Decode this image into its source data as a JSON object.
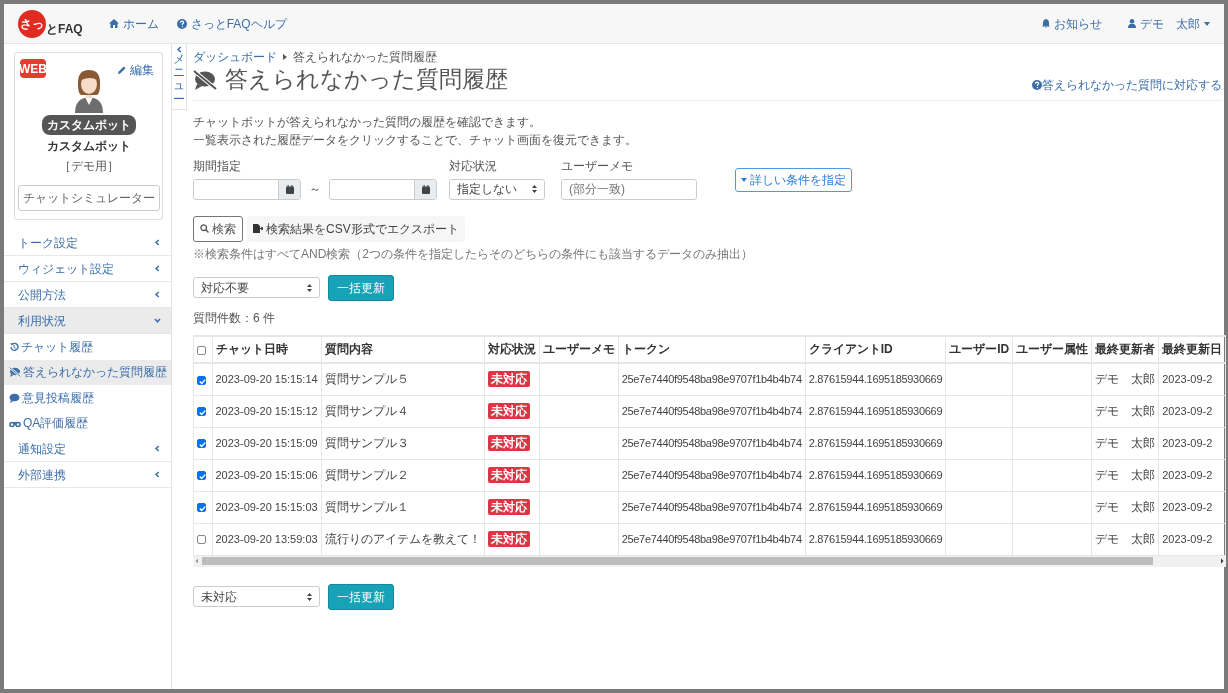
{
  "navbar": {
    "logo": {
      "mark": "さっ",
      "text": "とFAQ"
    },
    "links": [
      {
        "label": "ホーム"
      },
      {
        "label": "さっとFAQヘルプ"
      }
    ],
    "notifications": "お知らせ",
    "user": "デモ　太郎"
  },
  "bot_card": {
    "badge": "WEB",
    "edit": "編集",
    "tag": "カスタムボット",
    "name": "カスタムボット",
    "note": "［デモ用］",
    "button": "チャットシミュレーター"
  },
  "sidebar": {
    "items": [
      {
        "label": "トーク設定",
        "expanded": false,
        "selected": false
      },
      {
        "label": "ウィジェット設定",
        "expanded": false,
        "selected": false
      },
      {
        "label": "公開方法",
        "expanded": false,
        "selected": false
      },
      {
        "label": "利用状況",
        "expanded": true,
        "selected": true,
        "children": [
          {
            "label": "チャット履歴",
            "selected": false
          },
          {
            "label": "答えられなかった質問履歴",
            "selected": true
          },
          {
            "label": "意見投稿履歴",
            "selected": false
          },
          {
            "label": "QA評価履歴",
            "selected": false
          }
        ]
      },
      {
        "label": "通知設定",
        "expanded": false,
        "selected": false
      },
      {
        "label": "外部連携",
        "expanded": false,
        "selected": false
      }
    ]
  },
  "menu_toggle": "メニュー",
  "breadcrumb": [
    "ダッシュボード",
    "答えられなかった質問履歴"
  ],
  "title": "答えられなかった質問履歴",
  "help_link": "答えられなかった質問に対応する",
  "description": [
    "チャットボットが答えられなかった質問の履歴を確認できます。",
    "一覧表示された履歴データをクリックすることで、チャット画面を復元できます。"
  ],
  "filters": {
    "period_label": "期間指定",
    "separator": "～",
    "status_label": "対応状況",
    "status_value": "指定しない",
    "memo_label": "ユーザーメモ",
    "memo_placeholder": "(部分一致)",
    "advanced": "詳しい条件を指定"
  },
  "search_button": "検索",
  "export_button": "検索結果をCSV形式でエクスポート",
  "search_note": "※検索条件はすべてAND検索（2つの条件を指定したらそのどちらの条件にも該当するデータのみ抽出）",
  "bulk_top": {
    "value": "対応不要",
    "button": "一括更新"
  },
  "count": "質問件数：6 件",
  "table": {
    "all_checked": false,
    "columns": [
      "チャット日時",
      "質問内容",
      "対応状況",
      "ユーザーメモ",
      "トークン",
      "クライアントID",
      "ユーザーID",
      "ユーザー属性",
      "最終更新者",
      "最終更新日"
    ],
    "rows": [
      {
        "checked": true,
        "date": "2023-09-20 15:15:14",
        "question": "質問サンプル５",
        "status": "未対応",
        "token": "25e7e7440f9548ba98e9707f1b4b4b74",
        "client_id": "2.87615944.1695185930669",
        "updater": "デモ　太郎",
        "updated": "2023-09-2"
      },
      {
        "checked": true,
        "date": "2023-09-20 15:15:12",
        "question": "質問サンプル４",
        "status": "未対応",
        "token": "25e7e7440f9548ba98e9707f1b4b4b74",
        "client_id": "2.87615944.1695185930669",
        "updater": "デモ　太郎",
        "updated": "2023-09-2"
      },
      {
        "checked": true,
        "date": "2023-09-20 15:15:09",
        "question": "質問サンプル３",
        "status": "未対応",
        "token": "25e7e7440f9548ba98e9707f1b4b4b74",
        "client_id": "2.87615944.1695185930669",
        "updater": "デモ　太郎",
        "updated": "2023-09-2"
      },
      {
        "checked": true,
        "date": "2023-09-20 15:15:06",
        "question": "質問サンプル２",
        "status": "未対応",
        "token": "25e7e7440f9548ba98e9707f1b4b4b74",
        "client_id": "2.87615944.1695185930669",
        "updater": "デモ　太郎",
        "updated": "2023-09-2"
      },
      {
        "checked": true,
        "date": "2023-09-20 15:15:03",
        "question": "質問サンプル１",
        "status": "未対応",
        "token": "25e7e7440f9548ba98e9707f1b4b4b74",
        "client_id": "2.87615944.1695185930669",
        "updater": "デモ　太郎",
        "updated": "2023-09-2"
      },
      {
        "checked": false,
        "date": "2023-09-20 13:59:03",
        "question": "流行りのアイテムを教えて！",
        "status": "未対応",
        "token": "25e7e7440f9548ba98e9707f1b4b4b74",
        "client_id": "2.87615944.1695185930669",
        "updater": "デモ　太郎",
        "updated": "2023-09-2"
      }
    ]
  },
  "bulk_bottom": {
    "value": "未対応",
    "button": "一括更新"
  }
}
